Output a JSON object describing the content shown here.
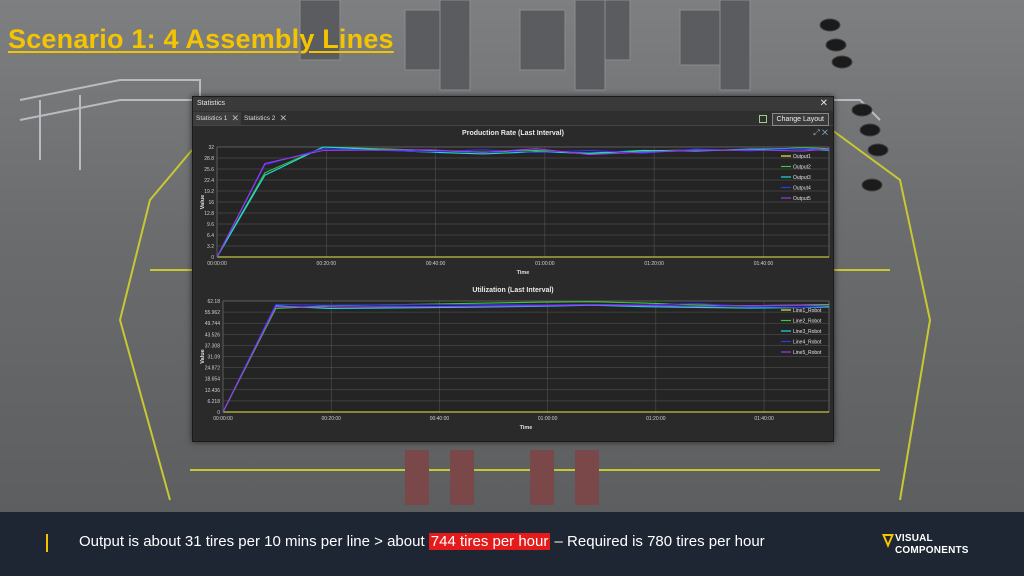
{
  "slide": {
    "title": "Scenario 1: 4 Assembly Lines",
    "footer_text_before": "Output is about 31 tires per 10 mins per line > about ",
    "footer_highlight": "744 tires per hour",
    "footer_text_after": " – Required is 780 tires per hour",
    "logo_line1": "VISUAL",
    "logo_line2": "COMPONENTS"
  },
  "window": {
    "title": "Statistics",
    "tabs": [
      {
        "label": "Statistics 1"
      },
      {
        "label": "Statistics 2"
      }
    ],
    "change_layout_label": "Change Layout"
  },
  "chart_data": [
    {
      "type": "line",
      "title": "Production Rate (Last Interval)",
      "xlabel": "Time",
      "ylabel": "Value",
      "x_ticks": [
        "00:00:00",
        "00:20:00",
        "00:40:00",
        "01:00:00",
        "01:20:00",
        "01:40:00"
      ],
      "y_ticks": [
        "0",
        "3.2",
        "6.4",
        "9.6",
        "12.8",
        "16",
        "19.2",
        "22.4",
        "25.6",
        "28.8",
        "32"
      ],
      "xlim": [
        0,
        115
      ],
      "ylim": [
        0,
        32
      ],
      "x": [
        0,
        9,
        20,
        40,
        50,
        60,
        70,
        80,
        90,
        100,
        110,
        115
      ],
      "series": [
        {
          "name": "Output1",
          "color": "#e8e84a",
          "values": [
            0,
            0,
            0,
            0,
            0,
            0,
            0,
            0,
            0,
            0,
            0,
            0
          ]
        },
        {
          "name": "Output2",
          "color": "#3ec63e",
          "values": [
            0,
            24.5,
            32,
            31,
            30.5,
            31,
            30,
            30.8,
            31.2,
            31,
            31.8,
            31.5
          ]
        },
        {
          "name": "Output3",
          "color": "#20d8e0",
          "values": [
            0,
            23.8,
            32,
            30.5,
            30,
            30.6,
            30.2,
            31,
            30.8,
            31.4,
            31.5,
            31
          ]
        },
        {
          "name": "Output4",
          "color": "#3434f0",
          "values": [
            0,
            26.8,
            31.5,
            30.6,
            31.2,
            30.4,
            31,
            30.2,
            31.4,
            30.9,
            31.6,
            31.2
          ]
        },
        {
          "name": "Output5",
          "color": "#9a3be0",
          "values": [
            0,
            27.2,
            31,
            31.2,
            30.4,
            31.5,
            29.8,
            30.5,
            31,
            31.2,
            30.8,
            31.4
          ]
        }
      ],
      "legend_position": "top-right",
      "grid": true
    },
    {
      "type": "line",
      "title": "Utilization (Last Interval)",
      "xlabel": "Time",
      "ylabel": "Value",
      "x_ticks": [
        "00:00:00",
        "00:20:00",
        "00:40:00",
        "01:00:00",
        "01:20:00",
        "01:40:00"
      ],
      "y_ticks": [
        "0",
        "6.218",
        "12.436",
        "18.654",
        "24.872",
        "31.09",
        "37.308",
        "43.526",
        "49.744",
        "55.962",
        "62.18"
      ],
      "xlim": [
        0,
        115
      ],
      "ylim": [
        0,
        62.18
      ],
      "x": [
        0,
        10,
        20,
        40,
        60,
        70,
        80,
        90,
        100,
        110,
        115
      ],
      "series": [
        {
          "name": "Line1_Robot",
          "color": "#e8e84a",
          "values": [
            0,
            0,
            0,
            0,
            0,
            0,
            0,
            0,
            0,
            0,
            0
          ]
        },
        {
          "name": "Line2_Robot",
          "color": "#3ec63e",
          "values": [
            0,
            58,
            59.5,
            60.5,
            61.5,
            61.8,
            61,
            60,
            59.5,
            60,
            60.2
          ]
        },
        {
          "name": "Line3_Robot",
          "color": "#20d8e0",
          "values": [
            0,
            59.5,
            58,
            58.5,
            59.2,
            59.8,
            59,
            58.6,
            58.2,
            58.5,
            58.8
          ]
        },
        {
          "name": "Line4_Robot",
          "color": "#3434f0",
          "values": [
            0,
            60.2,
            59.8,
            60.2,
            60,
            60.3,
            60,
            60.8,
            59,
            58.6,
            59.5
          ]
        },
        {
          "name": "Line5_Robot",
          "color": "#9a3be0",
          "values": [
            0,
            59,
            58.8,
            59,
            59.5,
            60,
            59.6,
            59.2,
            59.6,
            59.8,
            59.4
          ]
        }
      ],
      "legend_position": "top-right",
      "grid": true
    }
  ]
}
